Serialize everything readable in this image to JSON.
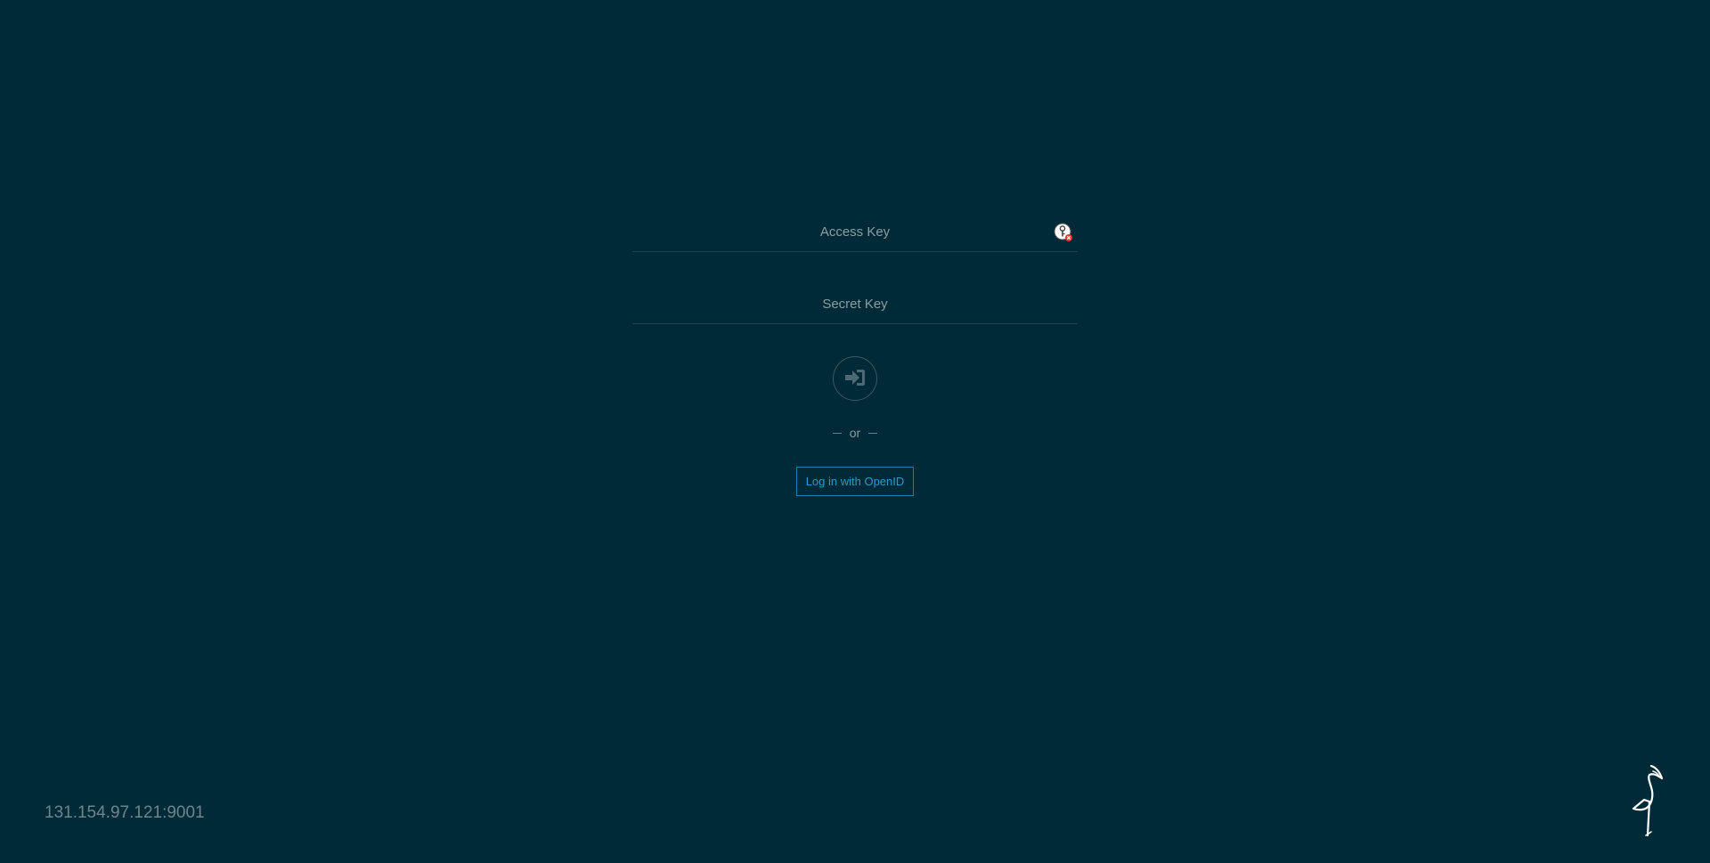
{
  "login": {
    "access_key_placeholder": "Access Key",
    "secret_key_placeholder": "Secret Key",
    "or_text": "or",
    "openid_label": "Log in with OpenID"
  },
  "footer": {
    "host": "131.154.97.121:9001"
  },
  "icons": {
    "password_manager": "key-warning-icon",
    "submit": "sign-in-arrow-icon",
    "logo": "minio-flamingo-logo"
  },
  "colors": {
    "background": "#002a37",
    "accent": "#2a9ad0",
    "muted_text": "#8a9ea4"
  }
}
